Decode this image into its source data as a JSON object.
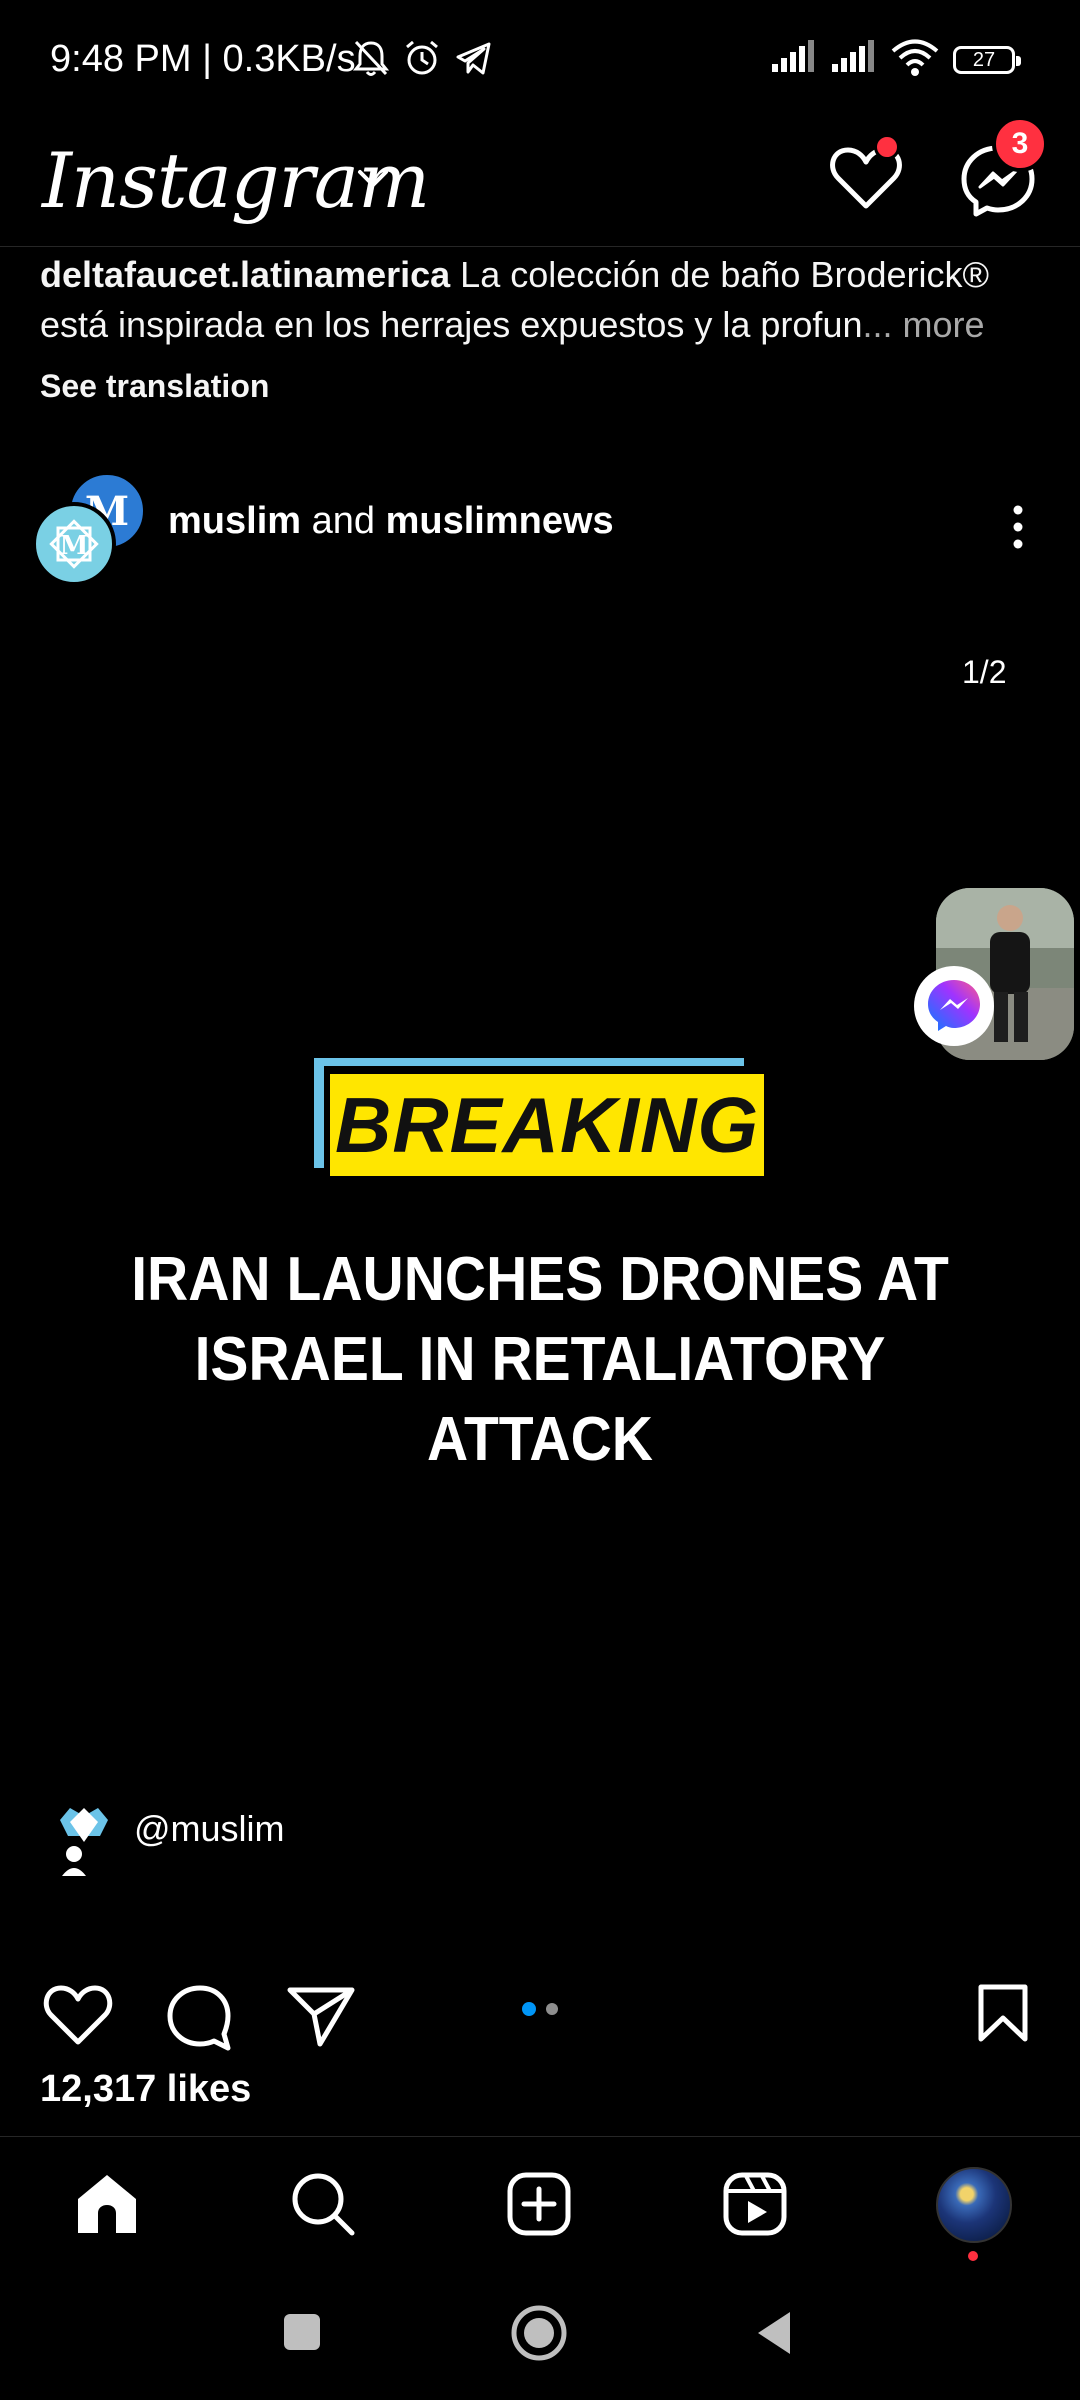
{
  "status_bar": {
    "time": "9:48 PM | 0.3KB/s",
    "battery": "27"
  },
  "header": {
    "logo": "Instagram",
    "messages_badge": "3"
  },
  "previous_post": {
    "username": "deltafaucet.latinamerica",
    "caption": " La colección de baño Broderick® está inspirada en los herrajes expuestos y la profun",
    "more_label": "... more",
    "see_translation": "See translation"
  },
  "post": {
    "author1": "muslim",
    "joiner": " and ",
    "author2": "muslimnews",
    "avatar_letter": "M",
    "counter": "1/2",
    "breaking_label": "BREAKING",
    "headline": "IRAN LAUNCHES DRONES AT ISRAEL IN RETALIATORY ATTACK",
    "tag_user": "@muslim",
    "likes": "12,317 likes",
    "carousel_active_index": 0,
    "carousel_total": 2
  },
  "colors": {
    "accent_blue": "#0095f6",
    "notification_red": "#ff3040",
    "breaking_yellow": "#ffe600",
    "breaking_blue": "#6bc3e8"
  }
}
